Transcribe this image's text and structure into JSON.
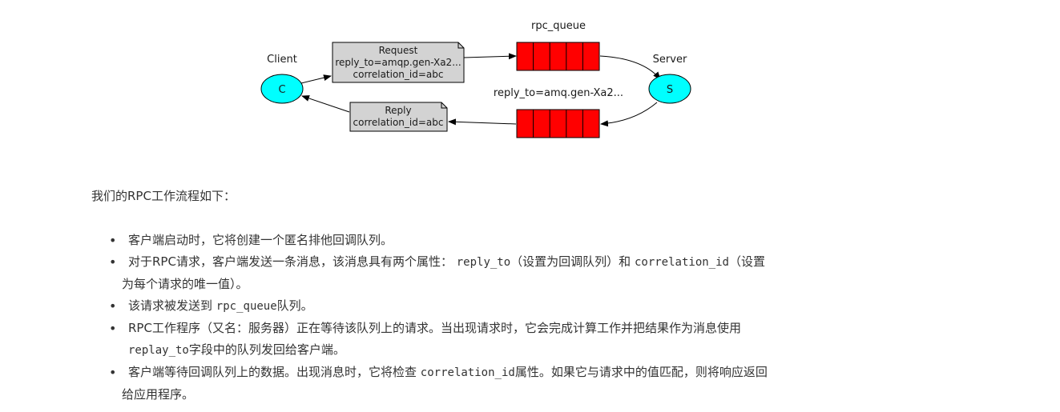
{
  "diagram": {
    "client_label": "Client",
    "client_node": "C",
    "server_label": "Server",
    "server_node": "S",
    "rpc_queue_label": "rpc_queue",
    "reply_queue_label": "reply_to=amq.gen-Xa2...",
    "request_note": [
      "Request",
      "reply_to=amqp.gen-Xa2...",
      "correlation_id=abc"
    ],
    "reply_note": [
      "Reply",
      "correlation_id=abc"
    ],
    "colors": {
      "node": "#00ffff",
      "queue": "#ff0000",
      "note": "#d3d3d3"
    }
  },
  "intro": "我们的RPC工作流程如下：",
  "steps": [
    {
      "text": "客户端启动时，它将创建一个匿名排他回调队列。"
    },
    {
      "t1": "对于RPC请求，客户端发送一条消息，该消息具有两个属性：",
      "c1": "reply_to",
      "t2": "（设置为回调队列）和",
      "c2": "correlation_id",
      "t3": "（设置",
      "t4": "为每个请求的唯一值）。"
    },
    {
      "t1": "该请求被发送到",
      "c1": "rpc_queue",
      "t2": "队列。"
    },
    {
      "t1": "RPC工作程序（又名：服务器）正在等待该队列上的请求。当出现请求时，它会完成计算工作并把结果作为消息使用",
      "c1": "replay_to",
      "t2": "字段中的队列发回给客户端。"
    },
    {
      "t1": "客户端等待回调队列上的数据。出现消息时，它将检查",
      "c1": "correlation_id",
      "t2": "属性。如果它与请求中的值匹配，则将响应返回",
      "t3": "给应用程序。"
    }
  ]
}
